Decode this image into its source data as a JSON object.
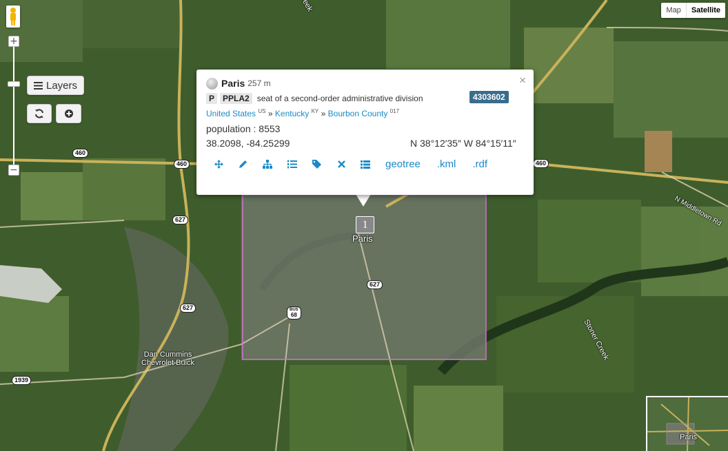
{
  "map_type": {
    "map_label": "Map",
    "satellite_label": "Satellite",
    "selected": "Satellite"
  },
  "controls": {
    "layers_label": "Layers",
    "zoom_in": "+",
    "zoom_out": "−"
  },
  "popup": {
    "name": "Paris",
    "elevation": "257 m",
    "feature_class": "P",
    "feature_code": "PPLA2",
    "description": "seat of a second-order administrative division",
    "geoname_id": "4303602",
    "breadcrumb": [
      {
        "name": "United States",
        "code": "US"
      },
      {
        "name": "Kentucky",
        "code": "KY"
      },
      {
        "name": "Bourbon County",
        "code": "017"
      }
    ],
    "separator": "»",
    "population": "population : 8553",
    "latlng": "38.2098, -84.25299",
    "dms": "N 38°12′35″ W 84°15′11″",
    "close": "×",
    "links": {
      "geotree": "geotree",
      "kml": ".kml",
      "rdf": ".rdf"
    }
  },
  "marker": {
    "label": "1"
  },
  "map_labels": {
    "paris": "Paris",
    "dealer": "Dan Cummins\nChevrolet Buick",
    "stoner_creek": "Stoner Creek",
    "middletown_rd": "N Middletown Rd",
    "creek": "eek",
    "overview_label": "Paris"
  },
  "shields": [
    "460",
    "460",
    "460",
    "627",
    "627",
    "627",
    "68",
    "1939",
    "68"
  ],
  "shield_bus": "BUS",
  "colors": {
    "link": "#1a8ac6",
    "badge": "#3a6d8c",
    "bbox": "#d070d0"
  }
}
